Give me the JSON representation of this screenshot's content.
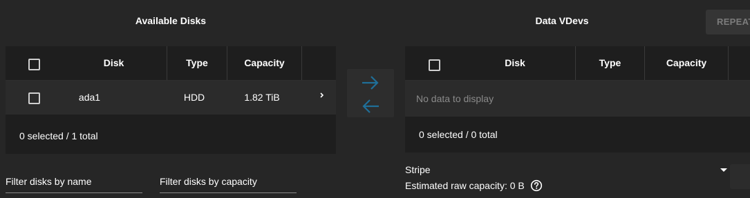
{
  "available": {
    "heading": "Available Disks",
    "columns": [
      "Disk",
      "Type",
      "Capacity"
    ],
    "rows": [
      {
        "disk": "ada1",
        "type": "HDD",
        "capacity": "1.82 TiB"
      }
    ],
    "footer": "0 selected / 1 total",
    "filter_name_label": "Filter disks by name",
    "filter_capacity_label": "Filter disks by capacity"
  },
  "vdevs": {
    "heading": "Data VDevs",
    "repeat_label": "REPEAT",
    "columns": [
      "Disk",
      "Type",
      "Capacity"
    ],
    "empty_text": "No data to display",
    "footer": "0 selected / 0 total",
    "layout_value": "Stripe",
    "estimated_label": "Estimated raw capacity: 0 B"
  },
  "icons": {
    "move_right": "arrow-right-icon",
    "move_left": "arrow-left-icon",
    "expand": "chevron-right-icon",
    "dropdown": "caret-down-icon",
    "help": "help-circle-icon"
  },
  "colors": {
    "background": "#262626",
    "table_bg": "#1e1e1e",
    "row_bg": "#2b2b2b",
    "arrow": "#1f6f99",
    "muted_text": "#8a8a8a"
  }
}
